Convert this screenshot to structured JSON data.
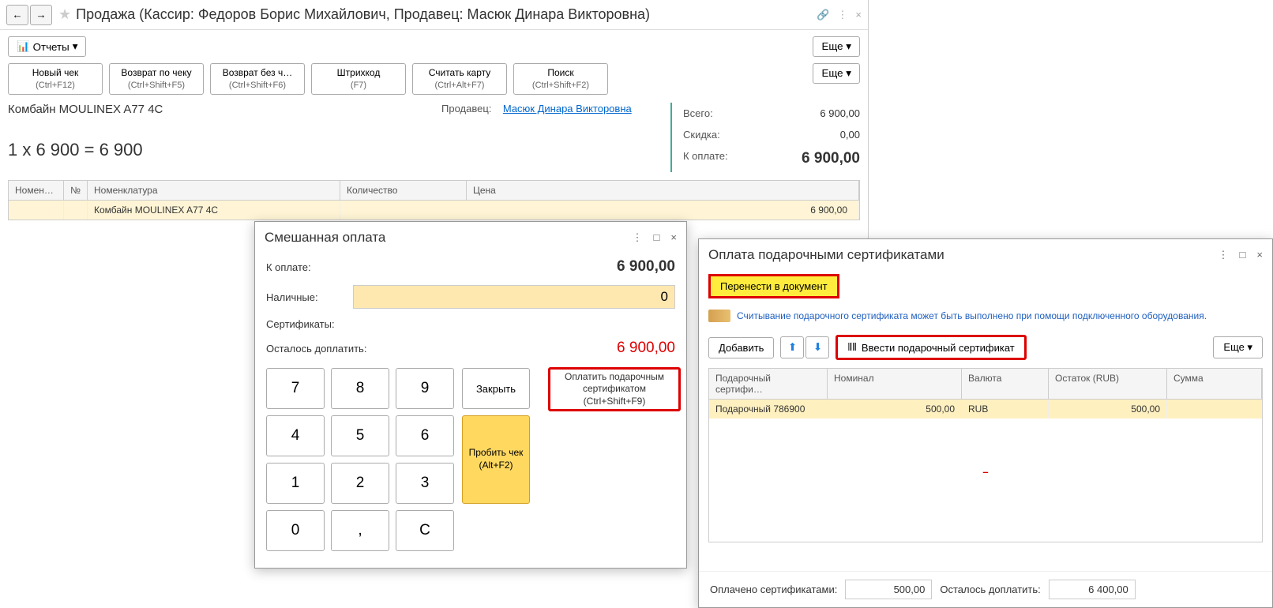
{
  "main": {
    "title": "Продажа (Кассир: Федоров Борис Михайлович, Продавец: Масюк Динара Викторовна)",
    "reports_btn": "Отчеты",
    "more_btn": "Еще",
    "actions": {
      "new_check": "Новый чек",
      "new_check_sub": "(Ctrl+F12)",
      "return_check": "Возврат по чеку",
      "return_check_sub": "(Ctrl+Shift+F5)",
      "return_no": "Возврат без ч…",
      "return_no_sub": "(Ctrl+Shift+F6)",
      "barcode": "Штрихкод",
      "barcode_sub": "(F7)",
      "read_card": "Считать карту",
      "read_card_sub": "(Ctrl+Alt+F7)",
      "search": "Поиск",
      "search_sub": "(Ctrl+Shift+F2)"
    },
    "item_name": "Комбайн MOULINEX  A77 4C",
    "seller_label": "Продавец:",
    "seller_name": "Масюк Динара Викторовна",
    "calc_line": "1 x 6 900 = 6 900",
    "totals": {
      "vsego_label": "Всего:",
      "vsego_val": "6 900,00",
      "skidka_label": "Скидка:",
      "skidka_val": "0,00",
      "koplate_label": "К оплате:",
      "koplate_val": "6 900,00"
    },
    "table": {
      "h1": "Номен…",
      "h2": "№",
      "h3": "Номенклатура",
      "h4": "Количество",
      "h5": "Цена",
      "row1_nom": "Комбайн MOULINEX  A77 4C",
      "row1_price": "6 900,00"
    }
  },
  "mixed": {
    "title": "Смешанная оплата",
    "koplate_label": "К оплате:",
    "koplate_val": "6 900,00",
    "cash_label": "Наличные:",
    "cash_val": "0",
    "cert_label": "Сертификаты:",
    "remain_label": "Осталось доплатить:",
    "remain_val": "6 900,00",
    "keys": [
      "7",
      "8",
      "9",
      "4",
      "5",
      "6",
      "1",
      "2",
      "3",
      "0",
      ",",
      "C"
    ],
    "close_btn": "Закрыть",
    "receipt_btn": "Пробить чек",
    "receipt_sub": "(Alt+F2)",
    "pay_cert_btn": "Оплатить подарочным сертификатом",
    "pay_cert_sub": "(Ctrl+Shift+F9)"
  },
  "cert": {
    "title": "Оплата подарочными сертификатами",
    "transfer_btn": "Перенести в документ",
    "info_text": "Считывание подарочного сертификата может быть выполнено при помощи подключенного оборудования.",
    "add_btn": "Добавить",
    "enter_cert_btn": "Ввести подарочный сертификат",
    "more_btn": "Еще",
    "table": {
      "h1": "Подарочный сертифи…",
      "h2": "Номинал",
      "h3": "Валюта",
      "h4": "Остаток (RUB)",
      "h5": "Сумма",
      "r1c1": "Подарочный 786900",
      "r1c2": "500,00",
      "r1c3": "RUB",
      "r1c4": "500,00"
    },
    "footer": {
      "paid_label": "Оплачено сертификатами:",
      "paid_val": "500,00",
      "remain_label": "Осталось доплатить:",
      "remain_val": "6 400,00"
    }
  }
}
